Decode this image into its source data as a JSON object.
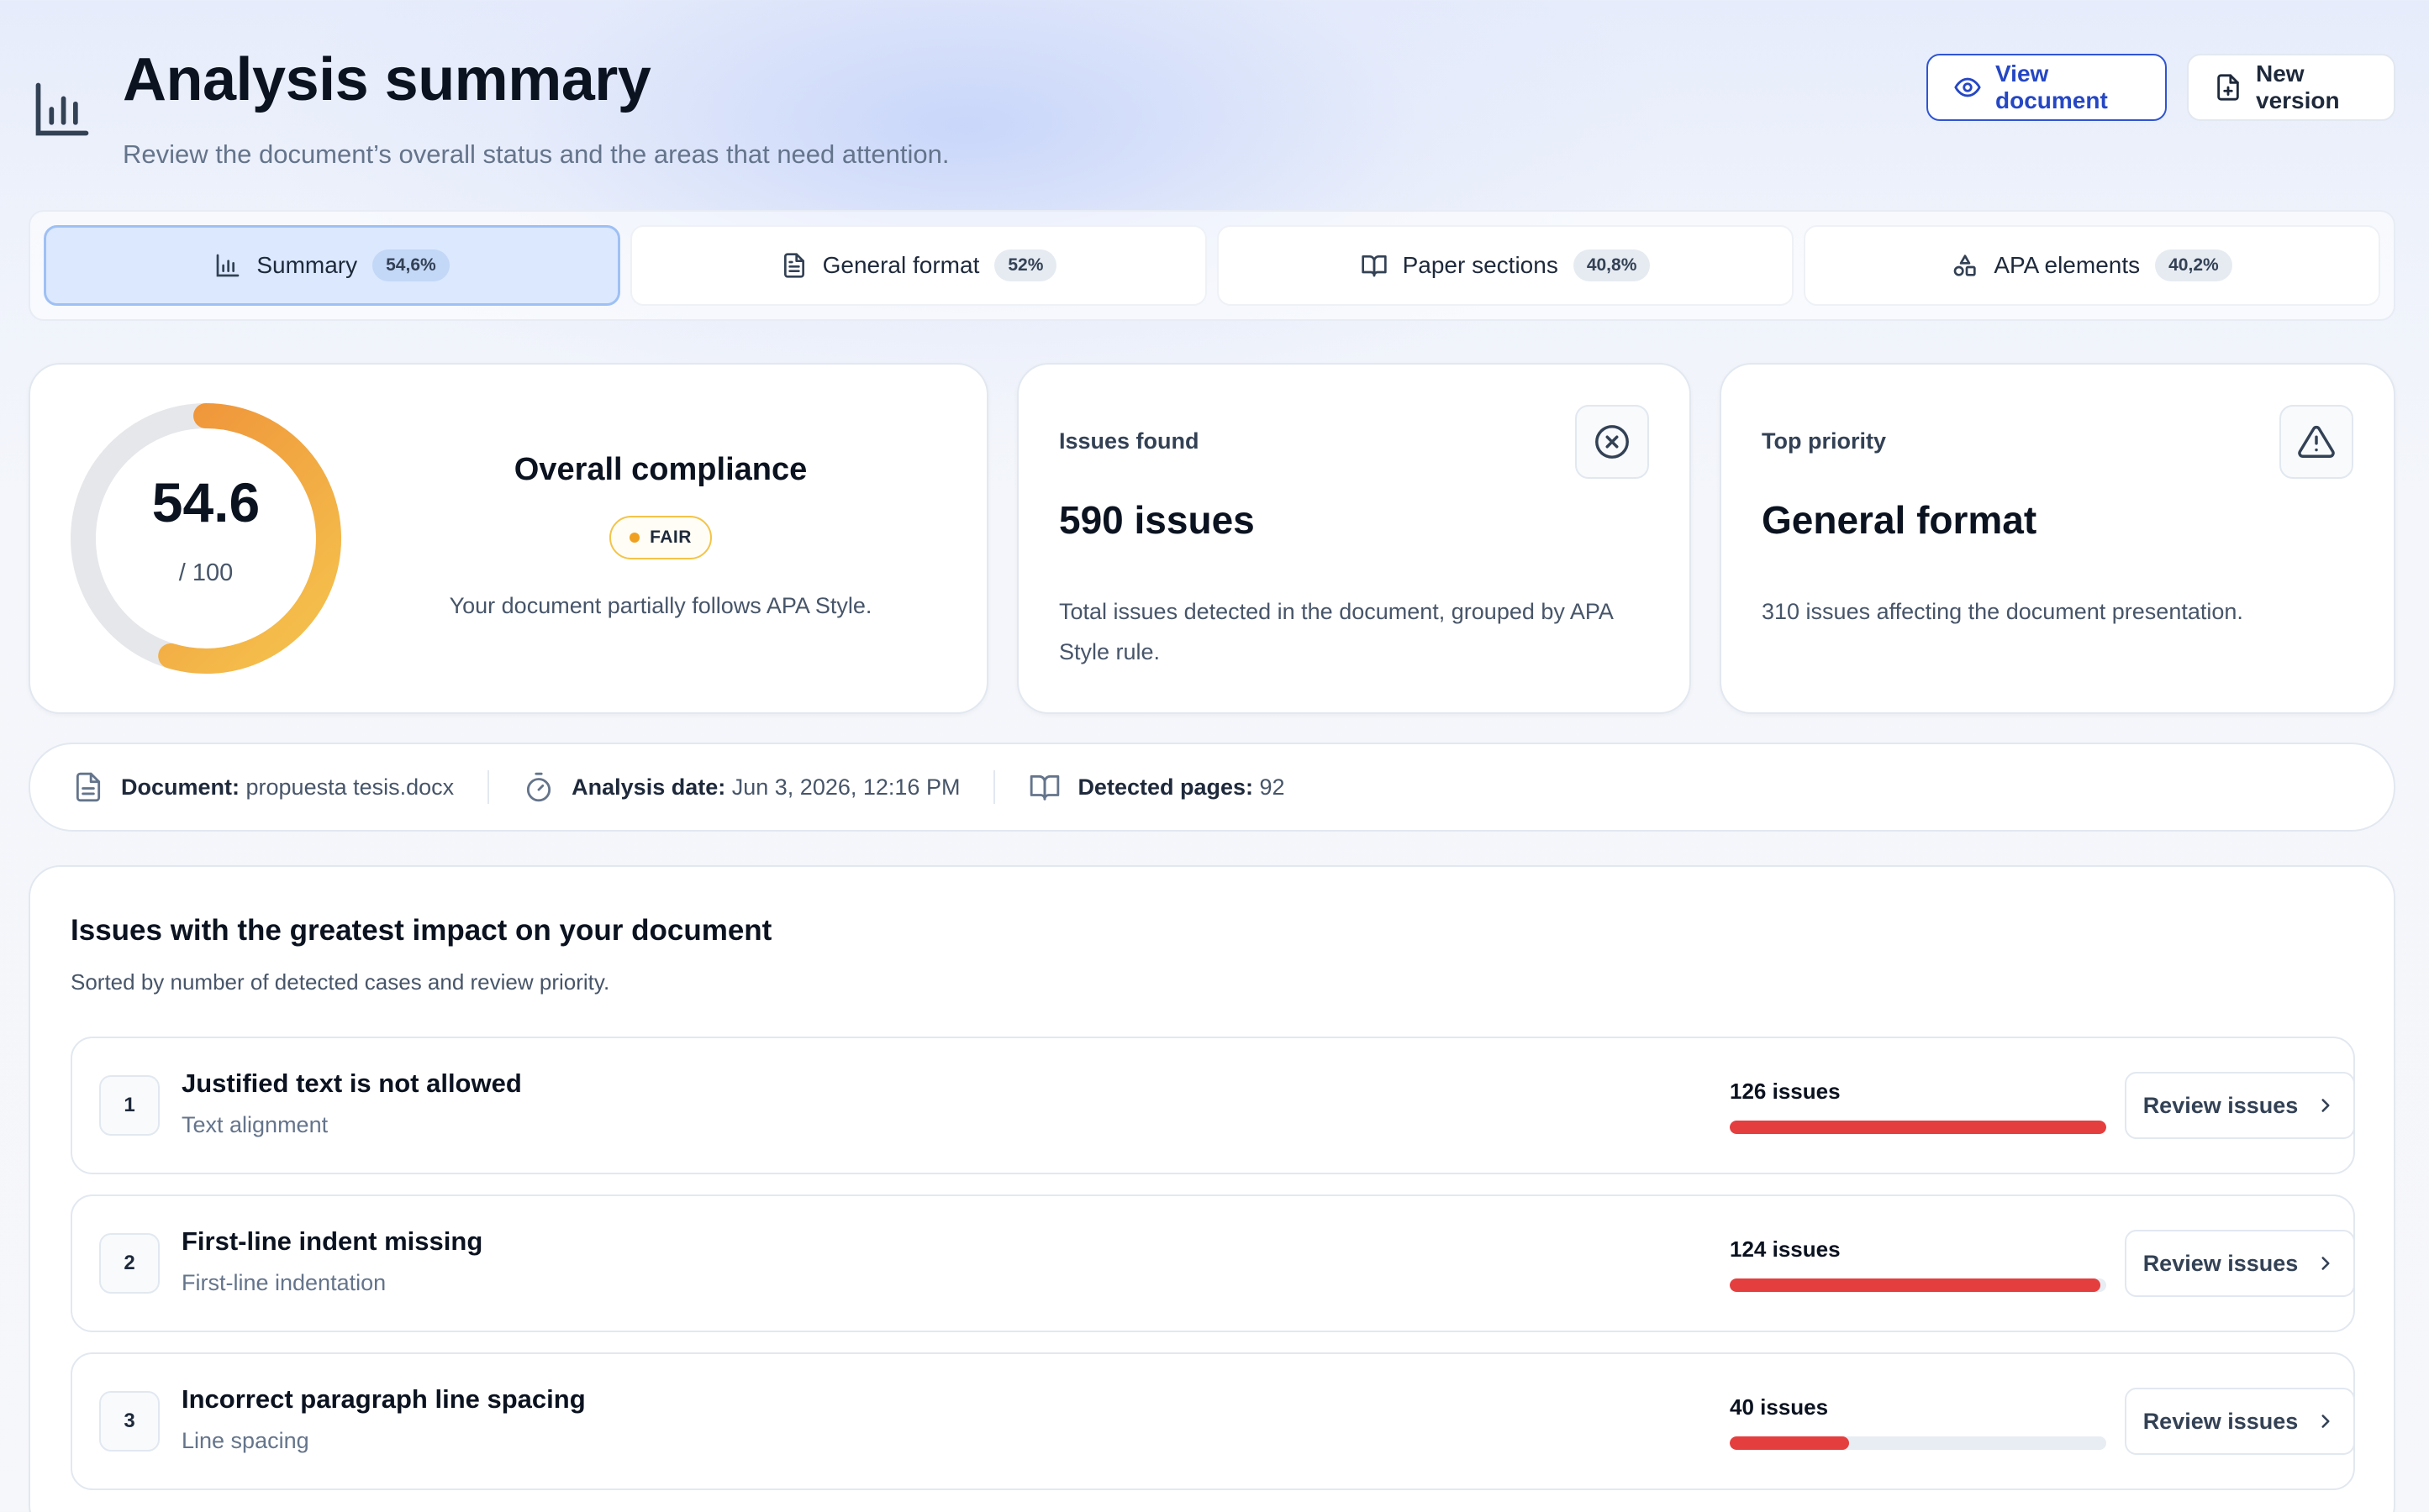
{
  "header": {
    "title": "Analysis summary",
    "subtitle": "Review the document’s overall status and the areas that need attention.",
    "view_label": "View document",
    "new_label": "New version"
  },
  "tabs": [
    {
      "label": "Summary",
      "badge": "54,6%",
      "icon": "bar-chart-icon",
      "active": true
    },
    {
      "label": "General format",
      "badge": "52%",
      "icon": "file-text-icon",
      "active": false
    },
    {
      "label": "Paper sections",
      "badge": "40,8%",
      "icon": "book-open-icon",
      "active": false
    },
    {
      "label": "APA elements",
      "badge": "40,2%",
      "icon": "shapes-icon",
      "active": false
    }
  ],
  "compliance": {
    "score": "54.6",
    "max": "/ 100",
    "score_value": 54.6,
    "title": "Overall compliance",
    "badge": "FAIR",
    "description": "Your document partially follows APA Style.",
    "colors": {
      "start": "#f5c44e",
      "end": "#ee8a36",
      "track": "#e6e7ea"
    }
  },
  "issues_card": {
    "label": "Issues found",
    "value": "590 issues",
    "description": "Total issues detected in the document, grouped by APA Style rule.",
    "icon": "x-circle-icon"
  },
  "priority_card": {
    "label": "Top priority",
    "value": "General format",
    "description": "310 issues affecting the document presentation.",
    "icon": "warning-triangle-icon"
  },
  "meta": {
    "document_label": "Document:",
    "document_value": "propuesta tesis.docx",
    "date_label": "Analysis date:",
    "date_value": "Jun 3, 2026, 12:16 PM",
    "pages_label": "Detected pages:",
    "pages_value": "92"
  },
  "impact": {
    "title": "Issues with the greatest impact on your document",
    "subtitle": "Sorted by number of detected cases and review priority.",
    "review_label": "Review issues",
    "bar_color": "#e53e3e",
    "items": [
      {
        "rank": "1",
        "title": "Justified text is not allowed",
        "category": "Text alignment",
        "count": "126 issues",
        "fraction": 1.0
      },
      {
        "rank": "2",
        "title": "First-line indent missing",
        "category": "First-line indentation",
        "count": "124 issues",
        "fraction": 0.984
      },
      {
        "rank": "3",
        "title": "Incorrect paragraph line spacing",
        "category": "Line spacing",
        "count": "40 issues",
        "fraction": 0.317
      }
    ]
  }
}
